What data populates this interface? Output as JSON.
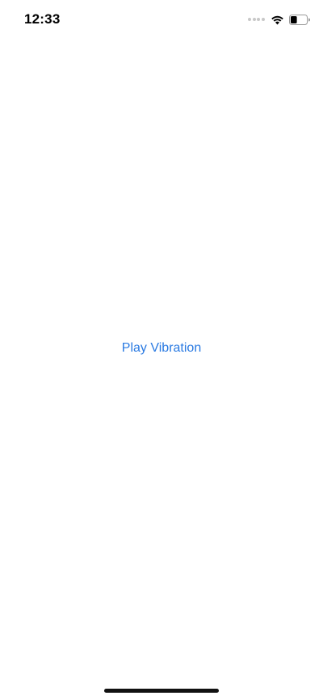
{
  "status_bar": {
    "time": "12:33",
    "signal_icon": "cellular-dots-icon",
    "wifi_icon": "wifi-icon",
    "battery_icon": "battery-icon",
    "battery_level": 0.4
  },
  "main": {
    "play_button_label": "Play Vibration"
  },
  "colors": {
    "accent": "#2a7ae2",
    "background": "#ffffff",
    "text": "#000000"
  }
}
